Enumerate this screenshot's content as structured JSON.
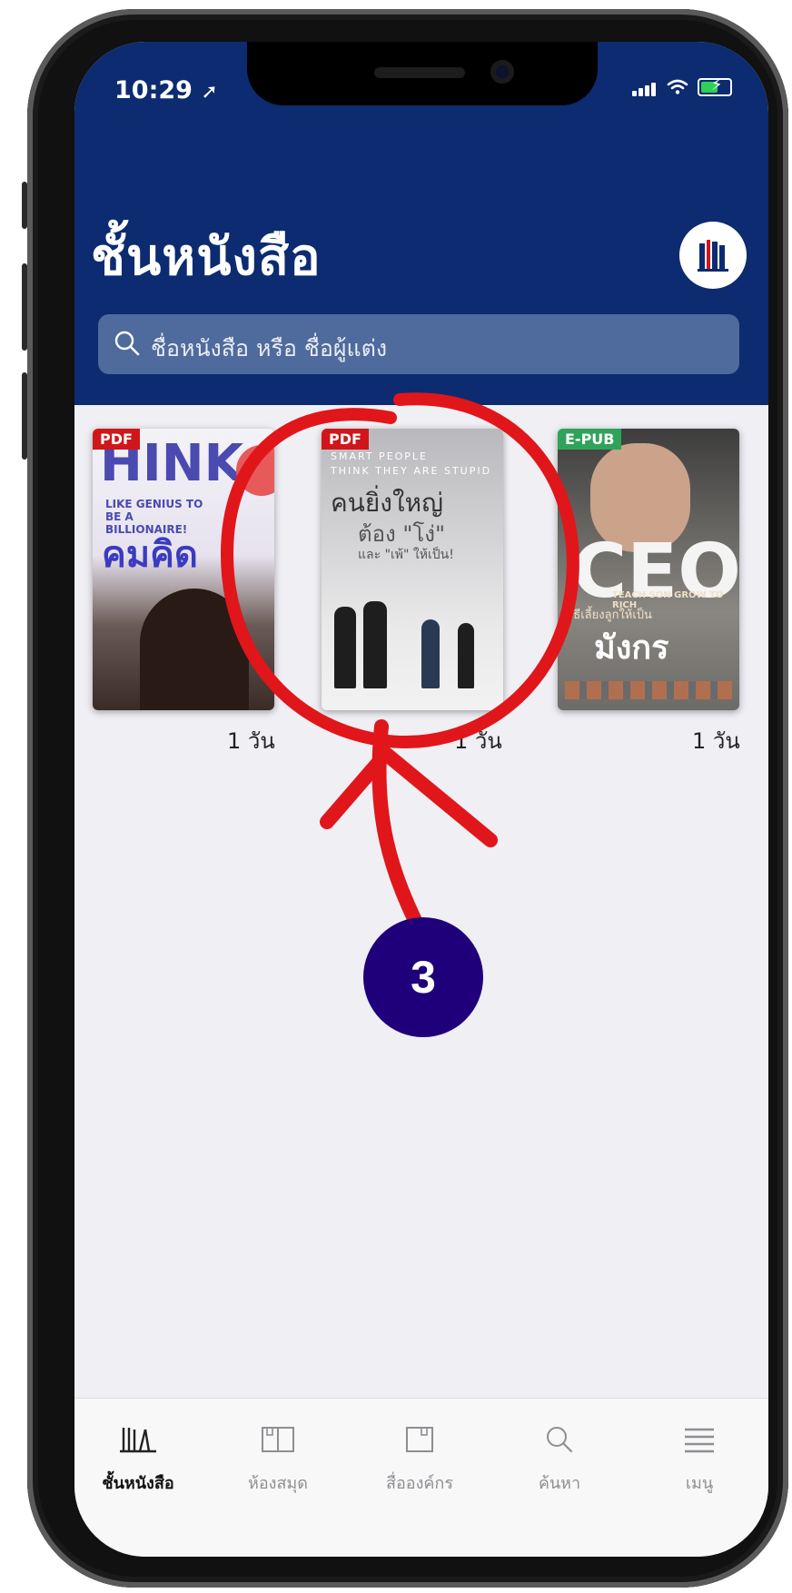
{
  "status": {
    "time": "10:29"
  },
  "header": {
    "title": "ชั้นหนังสือ",
    "search_placeholder": "ชื่อหนังสือ หรือ ชื่อผู้แต่ง"
  },
  "books": [
    {
      "badge": "PDF",
      "badge_color": "#d0161b",
      "cover_title": "คมคิด",
      "cover_tag": "LIKE GENIUS TO BE A BILLIONAIRE!",
      "cover_big": "HINK",
      "due": "1 วัน"
    },
    {
      "badge": "PDF",
      "badge_color": "#d0161b",
      "cover_line1": "SMART PEOPLE",
      "cover_line2": "THINK THEY ARE STUPID",
      "cover_title": "คนยิ่งใหญ่",
      "cover_sub": "ต้อง \"โง่\"",
      "cover_sub2": "และ \"เพ้\" ให้เป็น!",
      "due": "1 วัน"
    },
    {
      "badge": "E-PUB",
      "badge_color": "#2fa35a",
      "cover_big": "CEO",
      "cover_tag": "TEACH SON GROW TO RICH",
      "cover_title": "มังกร",
      "cover_sub": "วิธีเลี้ยงลูกให้เป็น",
      "due": "1 วัน"
    }
  ],
  "tabs": [
    {
      "label": "ชั้นหนังสือ",
      "icon": "bookshelf-icon",
      "active": true
    },
    {
      "label": "ห้องสมุด",
      "icon": "open-book-icon",
      "active": false
    },
    {
      "label": "สื่อองค์กร",
      "icon": "book-icon",
      "active": false
    },
    {
      "label": "ค้นหา",
      "icon": "search-icon",
      "active": false
    },
    {
      "label": "เมนู",
      "icon": "menu-icon",
      "active": false
    }
  ],
  "annotation": {
    "step_number": "3",
    "color": "#e0161b"
  }
}
